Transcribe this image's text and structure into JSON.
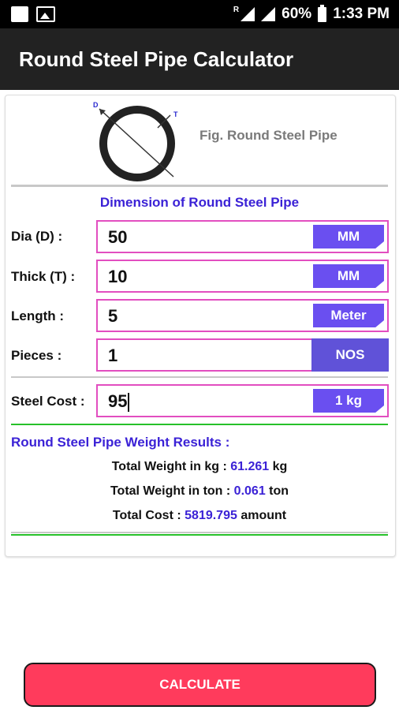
{
  "status_bar": {
    "battery": "60%",
    "time": "1:33 PM",
    "roaming": "R"
  },
  "app": {
    "title": "Round Steel Pipe Calculator"
  },
  "figure": {
    "caption": "Fig. Round Steel Pipe",
    "label_d": "D",
    "label_t": "T"
  },
  "dimension_title": "Dimension of Round Steel Pipe",
  "fields": [
    {
      "label": "Dia (D) :",
      "value": "50",
      "unit": "MM"
    },
    {
      "label": "Thick (T) :",
      "value": "10",
      "unit": "MM"
    },
    {
      "label": "Length :",
      "value": "5",
      "unit": "Meter"
    },
    {
      "label": "Pieces :",
      "value": "1",
      "unit": "NOS"
    },
    {
      "label": "Steel Cost :",
      "value": "95",
      "unit": "1 kg"
    }
  ],
  "results": {
    "title": "Round Steel Pipe Weight Results :",
    "weight_kg": {
      "label": "Total Weight in kg :",
      "value": "61.261",
      "unit": "kg"
    },
    "weight_ton": {
      "label": "Total Weight in ton :",
      "value": "0.061",
      "unit": "ton"
    },
    "total_cost": {
      "label": "Total Cost :",
      "value": "5819.795",
      "unit": "amount"
    }
  },
  "calculate_button": "CALCULATE",
  "colors": {
    "accent": "#3b22d6",
    "field_border": "#e24ec0",
    "unit_button": "#6a4ff0",
    "divider_green": "#27c12a",
    "calculate": "#ff3b5c"
  }
}
